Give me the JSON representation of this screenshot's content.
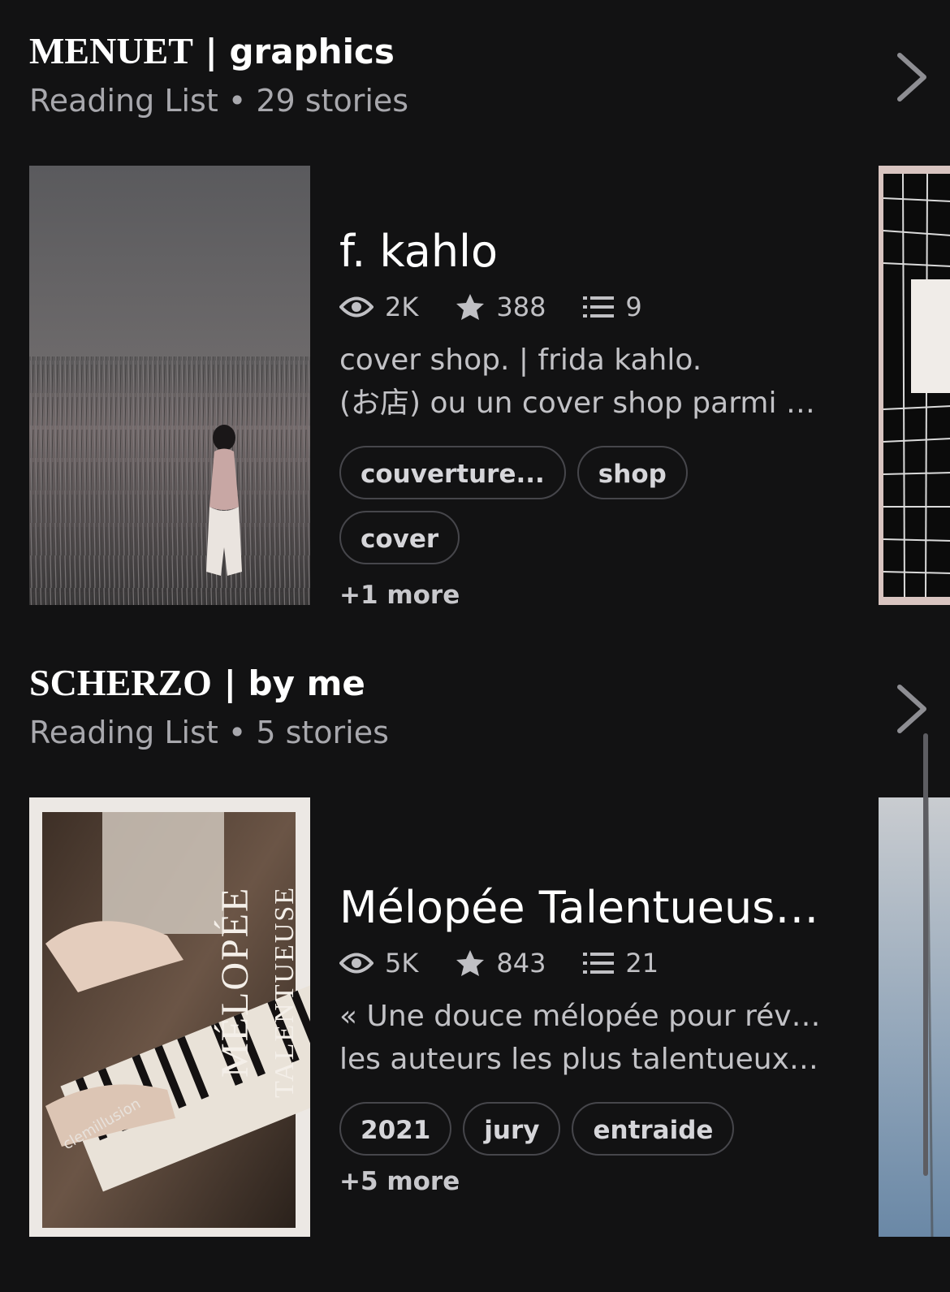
{
  "lists": [
    {
      "title_serif": "MENUET",
      "title_rest": " | graphics",
      "subtitle": "Reading List • 29 stories",
      "story": {
        "title": "f. kahlo",
        "views": "2K",
        "votes": "388",
        "parts": "9",
        "description_line1": "cover shop. |            frida kahlo.",
        "description_line2": "(お店) ou un cover shop parmi u…",
        "tags": [
          "couverture...",
          "shop",
          "cover"
        ],
        "more_tags": "+1 more"
      }
    },
    {
      "title_serif": "SCHERZO",
      "title_rest": " | by me",
      "subtitle": "Reading List • 5 stories",
      "story": {
        "title": "Mélopée Talentueuse…",
        "views": "5K",
        "votes": "843",
        "parts": "21",
        "description_line1": "« Une douce mélopée pour révéler",
        "description_line2": "les auteurs les plus talentueux a…",
        "tags": [
          "2021",
          "jury",
          "entraide"
        ],
        "more_tags": "+5 more",
        "cover_text_main": "MÉLOPÉE",
        "cover_text_sub": "TALENTUEUSE",
        "cover_signature": "clemillusion"
      }
    }
  ],
  "icons": {
    "views": "eye-icon",
    "votes": "star-icon",
    "parts": "list-icon",
    "open_list": "chevron-right-icon"
  },
  "colors": {
    "background": "#121213",
    "secondary_text": "#a8a8ad",
    "tag_border": "#46464b"
  }
}
